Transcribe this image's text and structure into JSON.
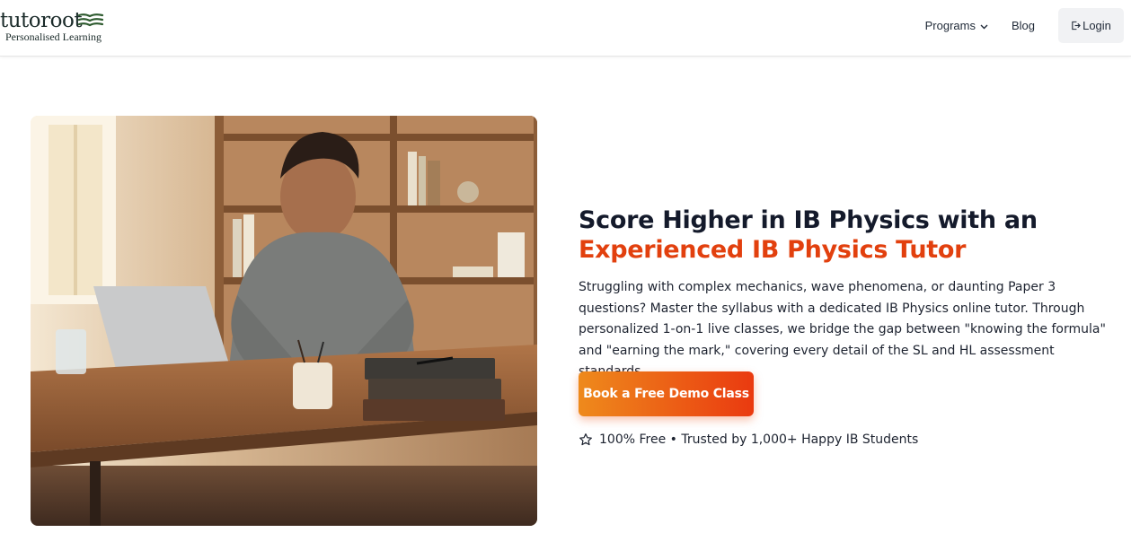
{
  "brand": {
    "name": "tutoroot",
    "tagline": "Personalised Learning",
    "brand_green": "#2d5a2e"
  },
  "nav": {
    "programs_label": "Programs",
    "blog_label": "Blog",
    "login_label": "Login"
  },
  "hero": {
    "headline_line1": "Score Higher in IB Physics with an",
    "headline_line2": "Experienced IB Physics Tutor",
    "description": "Struggling with complex mechanics, wave phenomena, or daunting Paper 3 questions? Master the syllabus with a dedicated IB Physics online tutor. Through personalized 1-on-1 live classes, we bridge the gap between \"knowing the formula\" and \"earning the mark,\" covering every detail of the SL and HL assessment standards.",
    "cta_label": "Book a Free Demo Class",
    "trust_text": "100% Free • Trusted by 1,000+ Happy IB Students",
    "accent_color": "#e2400e",
    "cta_gradient": [
      "#ee8a1c",
      "#ea3a10"
    ]
  },
  "icons": {
    "logo": "open-book-icon",
    "programs_chevron": "chevron-down-icon",
    "login": "login-icon",
    "trust": "star-outline-icon"
  }
}
